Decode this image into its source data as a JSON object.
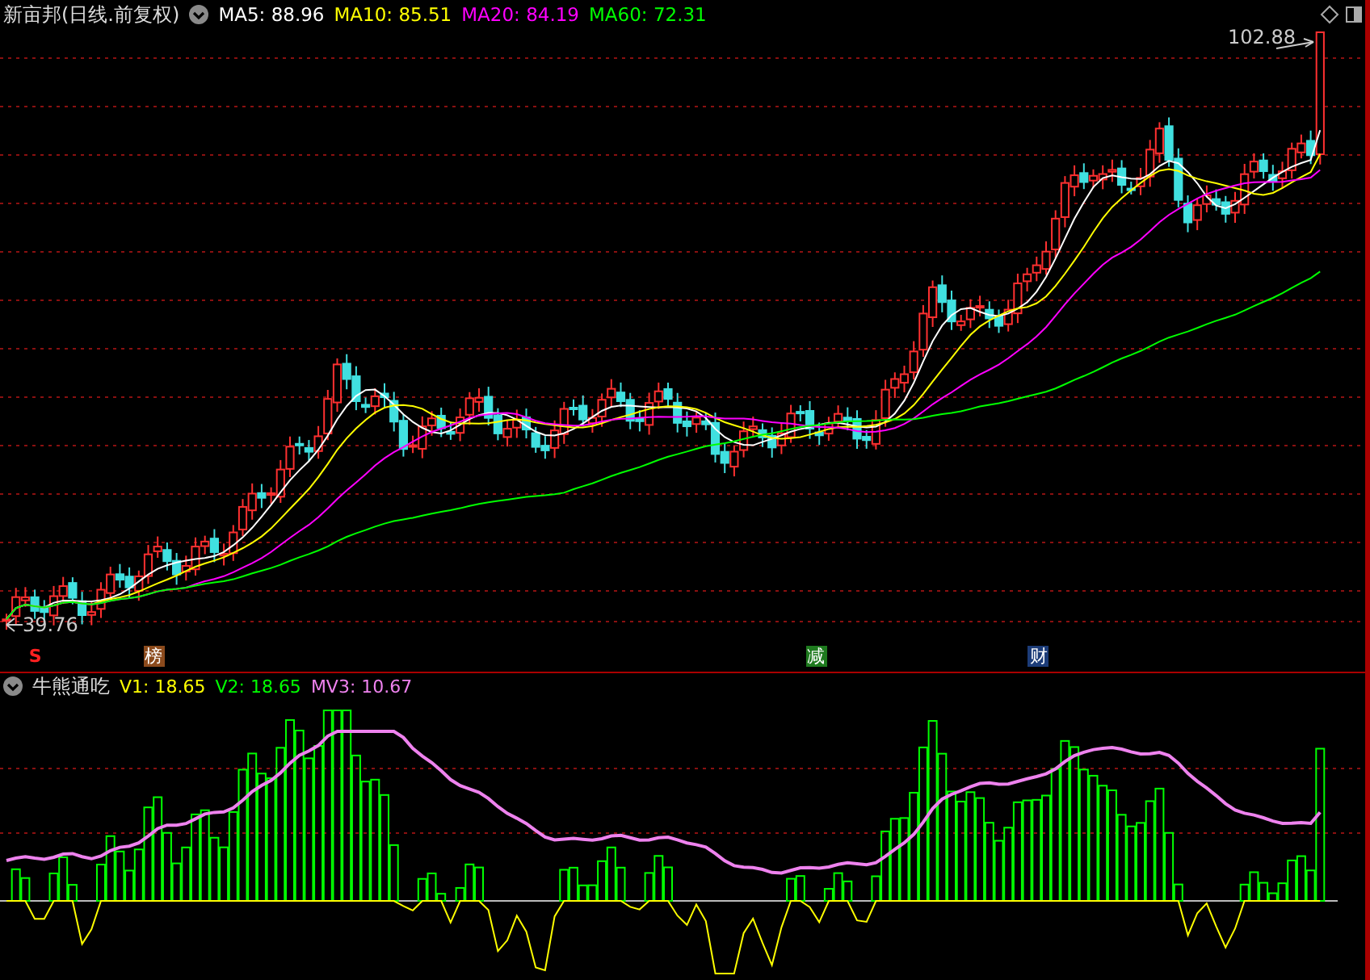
{
  "main": {
    "title": "新亩邦(日线.前复权)",
    "legend": [
      {
        "label": "MA5: 88.96",
        "color": "#ffffff"
      },
      {
        "label": "MA10: 85.51",
        "color": "#ffff00"
      },
      {
        "label": "MA20: 84.19",
        "color": "#ff00ff"
      },
      {
        "label": "MA60: 72.31",
        "color": "#00ff00"
      }
    ],
    "high_label": "102.88",
    "low_label": "39.76"
  },
  "markers": [
    {
      "kind": "signal",
      "label": "S",
      "color": "#ff2020"
    },
    {
      "kind": "tag",
      "label": "榜",
      "color": "#8b4a1c"
    },
    {
      "kind": "tag",
      "label": "减",
      "color": "#1e7a1e"
    },
    {
      "kind": "tag",
      "label": "财",
      "color": "#1c3c78"
    }
  ],
  "indicator": {
    "title": "牛熊通吃",
    "legend": [
      {
        "label": "V1: 18.65",
        "color": "#ffff00"
      },
      {
        "label": "V2: 18.65",
        "color": "#00ff00"
      },
      {
        "label": "MV3: 10.67",
        "color": "#ee82ee"
      }
    ]
  }
}
